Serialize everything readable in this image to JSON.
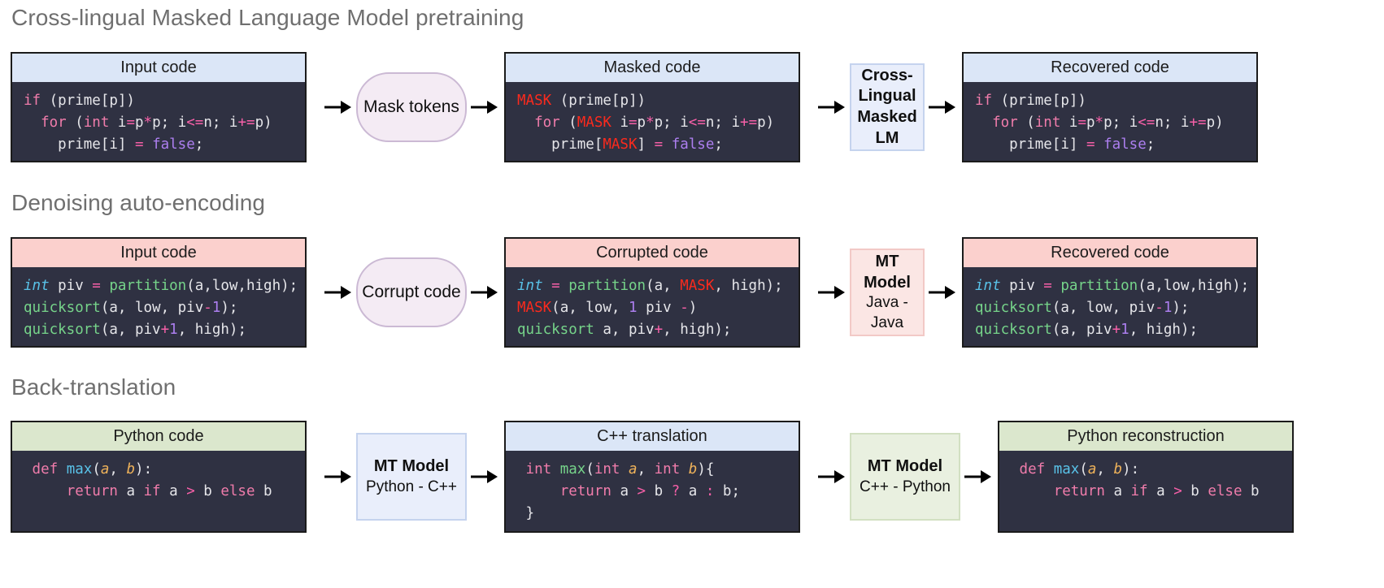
{
  "colors": {
    "panel_bg": "#2f3142",
    "header_blue": "#dbe6f7",
    "header_pink": "#fbd0cd",
    "header_green": "#dbe7cd",
    "title_gray": "#6f6f6f",
    "mask_red": "#fb2a1d",
    "keyword_pink": "#f07cab",
    "function_green": "#76d48a",
    "type_blue": "#59c2e8",
    "literal_purple": "#ad7ff0",
    "param_orange": "#f0b35a",
    "oval_fill": "#f4ebf4",
    "oval_border": "#cbb9d4"
  },
  "sections": [
    {
      "id": "mlm",
      "title": "Cross-lingual Masked Language Model pretraining",
      "panels": {
        "input": {
          "header": "Input code"
        },
        "middle": {
          "header": "Masked code"
        },
        "output": {
          "header": "Recovered code"
        }
      },
      "process_1": {
        "label": "Mask tokens",
        "shape": "oval"
      },
      "process_2": {
        "line1": "Cross-Lingual",
        "line2": "Masked LM",
        "shape": "rect"
      },
      "code_input": [
        "if (prime[p])",
        "  for (int i=p*p; i<=n; i+=p)",
        "    prime[i] = false;"
      ],
      "code_middle": [
        "MASK (prime[p])",
        "  for (MASK i=p*p; i<=n; i+=p)",
        "    prime[MASK] = false;"
      ],
      "code_output": [
        "if (prime[p])",
        "  for (int i=p*p; i<=n; i+=p)",
        "    prime[i] = false;"
      ]
    },
    {
      "id": "dae",
      "title": "Denoising auto-encoding",
      "panels": {
        "input": {
          "header": "Input code"
        },
        "middle": {
          "header": "Corrupted code"
        },
        "output": {
          "header": "Recovered code"
        }
      },
      "process_1": {
        "label": "Corrupt code",
        "shape": "oval"
      },
      "process_2": {
        "line1": "MT Model",
        "line2": "Java - Java",
        "shape": "rect"
      },
      "code_input": [
        "int piv = partition(a,low,high);",
        "quicksort(a, low, piv-1);",
        "quicksort(a, piv+1, high);"
      ],
      "code_middle": [
        "int = partition(a, MASK, high);",
        "MASK(a, low, 1 piv -)",
        "quicksort a, piv+, high);"
      ],
      "code_output": [
        "int piv = partition(a,low,high);",
        "quicksort(a, low, piv-1);",
        "quicksort(a, piv+1, high);"
      ]
    },
    {
      "id": "bt",
      "title": "Back-translation",
      "panels": {
        "input": {
          "header": "Python code"
        },
        "middle": {
          "header": "C++ translation"
        },
        "output": {
          "header": "Python reconstruction"
        }
      },
      "process_1": {
        "line1": "MT Model",
        "line2": "Python - C++",
        "shape": "rect"
      },
      "process_2": {
        "line1": "MT Model",
        "line2": "C++ - Python",
        "shape": "rect"
      },
      "code_input": [
        "def max(a, b):",
        "    return a if a > b else b"
      ],
      "code_middle": [
        "int max(int a, int b){",
        "    return a > b ? a : b;",
        "}"
      ],
      "code_output": [
        "def max(a, b):",
        "    return a if a > b else b"
      ]
    }
  ],
  "icons": {
    "arrow": "arrow-right-icon"
  }
}
